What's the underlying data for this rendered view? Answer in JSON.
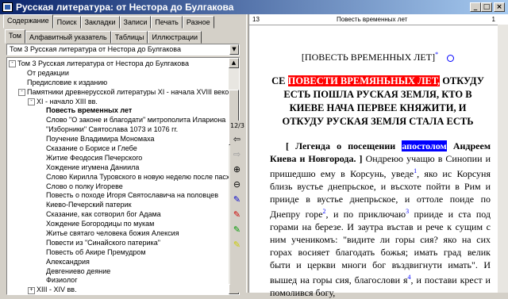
{
  "window": {
    "title": "Русская литература: от Нестора до Булгакова"
  },
  "window_buttons": [
    "_",
    "□",
    "×"
  ],
  "tabs": [
    "Содержание",
    "Поиск",
    "Закладки",
    "Записи",
    "Печать",
    "Разное"
  ],
  "subtabs": [
    "Том",
    "Алфавитный указатель",
    "Таблицы",
    "Иллюстрации"
  ],
  "volume_select": {
    "value": "Том 3 Русская литература от Нестора до Булгакова"
  },
  "tree": [
    {
      "label": "Том 3 Русская литература от Нестора до Булгакова",
      "expander": "-",
      "selected": false
    },
    {
      "label": "От редакции",
      "expander": "",
      "selected": false
    },
    {
      "label": "Предисловие к изданию",
      "expander": "",
      "selected": false
    },
    {
      "label": "Памятники древнерусской литературы XI - начала XVIII веков",
      "expander": "-",
      "selected": false
    },
    {
      "label": "XI - начало XIII вв.",
      "expander": "-",
      "selected": false
    },
    {
      "label": "Повесть временных лет",
      "expander": "",
      "selected": true
    },
    {
      "label": "Слово \"О законе и благодати\" митрополита Илариона",
      "expander": "",
      "selected": false
    },
    {
      "label": "\"Изборники\" Святослава 1073 и 1076 гг.",
      "expander": "",
      "selected": false
    },
    {
      "label": "Поучение Владимира Мономаха",
      "expander": "",
      "selected": false
    },
    {
      "label": "Сказание о Борисе и Глебе",
      "expander": "",
      "selected": false
    },
    {
      "label": "Житие Феодосия Печерского",
      "expander": "",
      "selected": false
    },
    {
      "label": "Хождение игумена Даниила",
      "expander": "",
      "selected": false
    },
    {
      "label": "Слово Кирилла Туровского в новую неделю после пасхи",
      "expander": "",
      "selected": false
    },
    {
      "label": "Слово о полку Игореве",
      "expander": "",
      "selected": false
    },
    {
      "label": "Повесть о походе Игоря Святославича на половцев",
      "expander": "",
      "selected": false
    },
    {
      "label": "Киево-Печерский патерик",
      "expander": "",
      "selected": false
    },
    {
      "label": "Сказание, как сотворил бог Адама",
      "expander": "",
      "selected": false
    },
    {
      "label": "Хождение Богородицы по мукам",
      "expander": "",
      "selected": false
    },
    {
      "label": "Житье святаго человека божия Алексия",
      "expander": "",
      "selected": false
    },
    {
      "label": "Повести из \"Синайского патерика\"",
      "expander": "",
      "selected": false
    },
    {
      "label": "Повесть об Акире Премудром",
      "expander": "",
      "selected": false
    },
    {
      "label": "Александрия",
      "expander": "",
      "selected": false
    },
    {
      "label": "Девгениево деяние",
      "expander": "",
      "selected": false
    },
    {
      "label": "Физиолог",
      "expander": "",
      "selected": false
    },
    {
      "label": "XIII - XIV вв.",
      "expander": "+",
      "selected": false
    }
  ],
  "page_header": {
    "page_num": "13",
    "title": "Повесть временных лет",
    "right_num": "1"
  },
  "page_counter": "12/3",
  "tools": [
    "arrow-left-icon",
    "arrow-right-icon",
    "zoom-in-icon",
    "zoom-out-icon",
    "pen-icon",
    "marker-red-icon",
    "marker-green-icon",
    "marker-yellow-icon"
  ],
  "doc": {
    "heading": "[ПОВЕСТЬ ВРЕМЕННЫХ ЛЕТ]",
    "heading_mark": "*",
    "title_pre": "СЕ ",
    "title_hl": "ПОВЕСТИ ВРЕМЯНЬНЫХ ЛЕТ,",
    "title_rest": " ОТКУДУ ЕСТЬ ПОШЛА РУСКАЯ ЗЕМЛЯ, КТО В КИЕВЕ НАЧА ПЕРВЕЕ КНЯЖИТИ, И ОТКУДУ РУСКАЯ ЗЕМЛЯ СТАЛА ЕСТЬ",
    "para_pre": "[ Легенда о посещении ",
    "para_hl": "апостолом",
    "para_b": " Андреем Киева и Новгорода. ]",
    "para_text": " Ондреюо учащю в Синопии и пришедшю ему в Корсунь, уведе",
    "sup1": "1",
    "para_text2": ", яко ис Корсуня близь вустье днепрьское, и въсхоте пойти в Рим и прииде в вустье днепрьское, и оттоле поиде по Днепру горе",
    "sup2": "2",
    "para_text3": ", и по приключаю",
    "sup3": "3",
    "para_text4": " прииде и ста под горами на березе. И заутра въстав и рече к сущим с ним ученикомъ: \"видите ли горы сия? яко на сих горах восияет благодать божья; имать град велик быти и церкви многи бог въздвигнути имать\". И вышед на горы сия, благослови я",
    "sup4": "4",
    "para_text5": ", и постави крест и помолився богу,"
  },
  "colors": {
    "title_gradient_start": "#0a246a",
    "title_gradient_end": "#a6caf0",
    "highlight_red": "#ff0000",
    "highlight_blue": "#0000ff"
  }
}
